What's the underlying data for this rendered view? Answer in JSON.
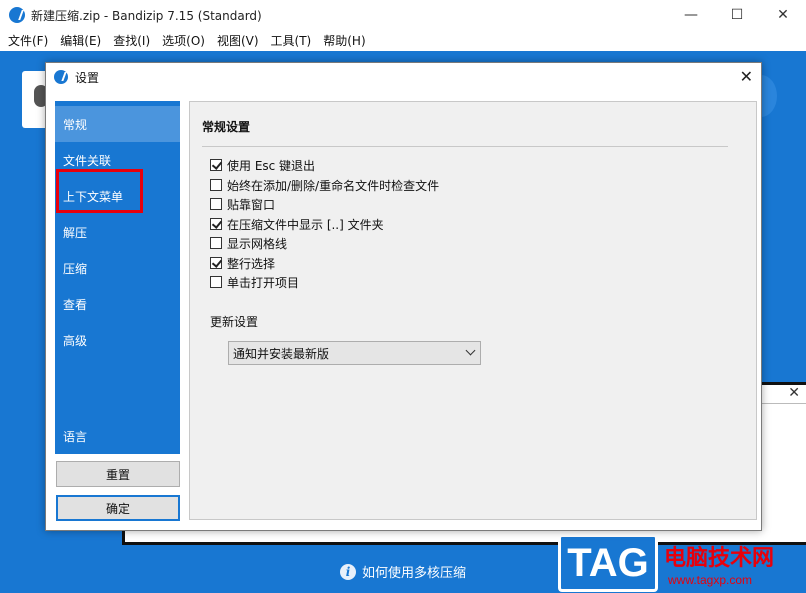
{
  "window": {
    "title": "新建压缩.zip - Bandizip 7.15 (Standard)",
    "minimize": "—",
    "maximize": "☐",
    "close": "✕"
  },
  "menu": [
    "文件(F)",
    "编辑(E)",
    "查找(I)",
    "选项(O)",
    "视图(V)",
    "工具(T)",
    "帮助(H)"
  ],
  "dialog": {
    "title": "设置",
    "close": "✕",
    "sidebar": {
      "items": [
        "常规",
        "文件关联",
        "上下文菜单",
        "解压",
        "压缩",
        "查看",
        "高级"
      ],
      "language": "语言",
      "active_index": 0,
      "highlighted_index": 2
    },
    "buttons": {
      "reset": "重置",
      "ok": "确定"
    },
    "general": {
      "section_title": "常规设置",
      "options": [
        {
          "label": "使用 Esc 键退出",
          "checked": true
        },
        {
          "label": "始终在添加/删除/重命名文件时检查文件",
          "checked": false
        },
        {
          "label": "贴靠窗口",
          "checked": false
        },
        {
          "label": "在压缩文件中显示 [..] 文件夹",
          "checked": true
        },
        {
          "label": "显示网格线",
          "checked": false
        },
        {
          "label": "整行选择",
          "checked": true
        },
        {
          "label": "单击打开项目",
          "checked": false
        }
      ],
      "update_title": "更新设置",
      "update_value": "通知并安装最新版"
    }
  },
  "subpanel": {
    "close": "✕"
  },
  "help": {
    "text": "如何使用多核压缩",
    "icon": "i"
  },
  "watermark": {
    "logo": "TAG",
    "site_name": "电脑技术网",
    "url": "www.tagxp.com"
  },
  "colors": {
    "accent": "#1877d2",
    "highlight": "#e8000b"
  }
}
